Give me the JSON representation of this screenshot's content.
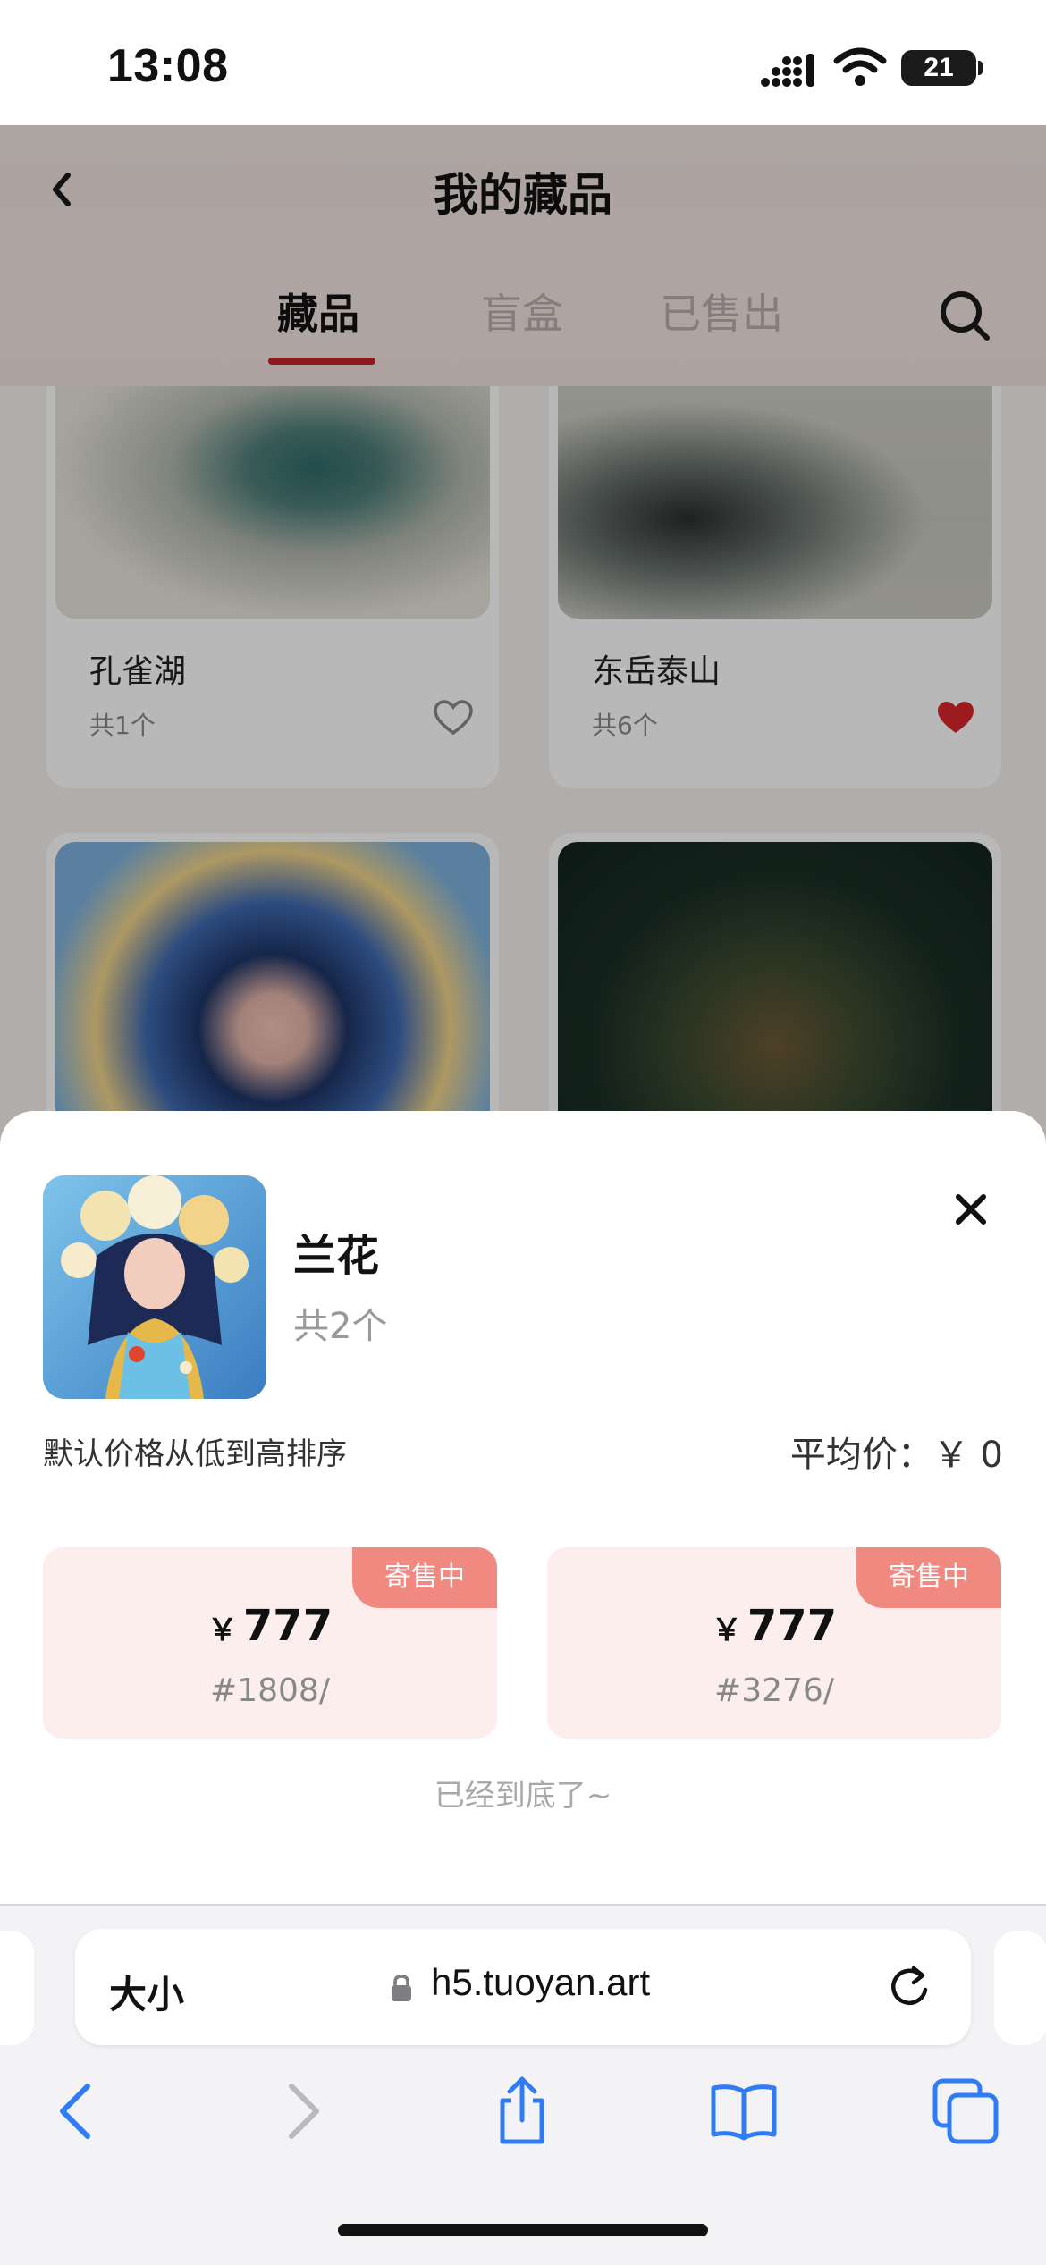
{
  "status_bar": {
    "time": "13:08",
    "battery": "21"
  },
  "header": {
    "title": "我的藏品"
  },
  "tabs": [
    {
      "label": "藏品",
      "active": true
    },
    {
      "label": "盲盒",
      "active": false
    },
    {
      "label": "已售出",
      "active": false
    }
  ],
  "grid": {
    "items": [
      {
        "name": "孔雀湖",
        "count": "共1个",
        "liked": false
      },
      {
        "name": "东岳泰山",
        "count": "共6个",
        "liked": true
      }
    ]
  },
  "sheet": {
    "name": "兰花",
    "count": "共2个",
    "sort_note": "默认价格从低到高排序",
    "avg_label": "平均价：￥",
    "avg_value": "0",
    "listings": [
      {
        "badge": "寄售中",
        "currency": "￥",
        "price": "777",
        "serial": "#1808/"
      },
      {
        "badge": "寄售中",
        "currency": "￥",
        "price": "777",
        "serial": "#3276/"
      }
    ],
    "end_note": "已经到底了~"
  },
  "browser": {
    "text_size_label": "大小",
    "url": "h5.tuoyan.art"
  },
  "colors": {
    "accent": "#c4232b",
    "badge": "#f08a80",
    "listing_bg": "#fdeeee",
    "safari_blue": "#2f7cf6"
  }
}
